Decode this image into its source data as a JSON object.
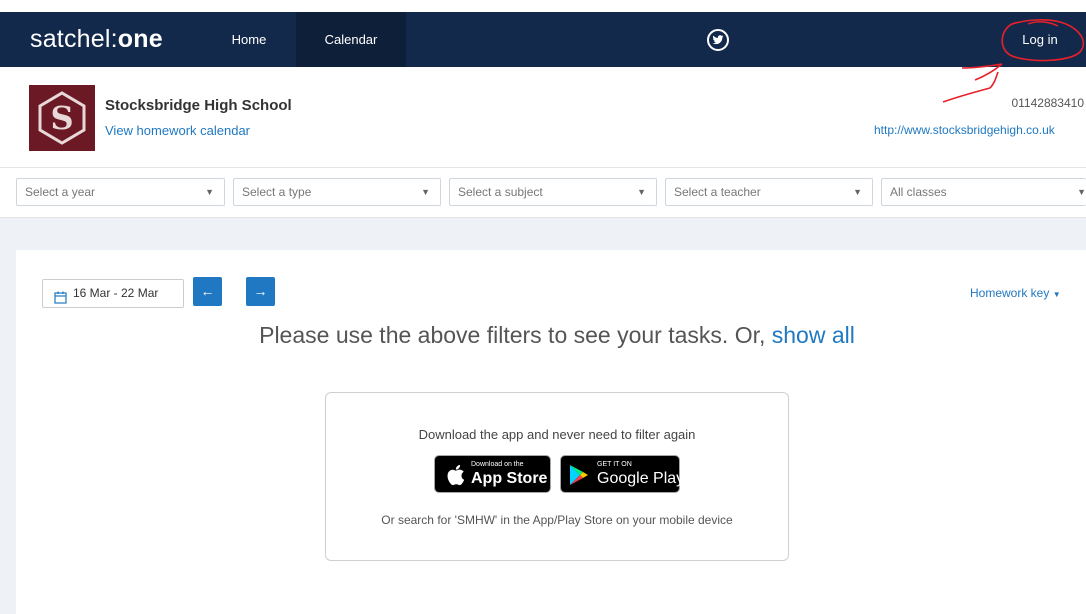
{
  "nav": {
    "brand_plain": "satchel:",
    "brand_bold": "one",
    "home": "Home",
    "calendar": "Calendar",
    "login": "Log in",
    "twitter_icon": "twitter-icon"
  },
  "school": {
    "name": "Stocksbridge High School",
    "calendar_link": "View homework calendar",
    "phone": "01142883410",
    "website": "http://www.stocksbridgehigh.co.uk"
  },
  "filters": {
    "year": "Select a year",
    "type": "Select a type",
    "subject": "Select a subject",
    "teacher": "Select a teacher",
    "classes": "All classes"
  },
  "toolbar": {
    "date_range": "16 Mar - 22 Mar",
    "prev_icon": "←",
    "next_icon": "→",
    "homework_key": "Homework key"
  },
  "main": {
    "prompt": "Please use the above filters to see your tasks. Or,",
    "show_all": "show all"
  },
  "app_promo": {
    "headline": "Download the app and never need to filter again",
    "appstore_small": "Download on the",
    "appstore_big": "App Store",
    "google_small": "GET IT ON",
    "google_big": "Google Play",
    "hint": "Or search for 'SMHW' in the App/Play Store on your mobile device"
  },
  "colors": {
    "nav_bg": "#13294b",
    "accent": "#1f78c1",
    "logo_bg": "#6b1a25",
    "annotation": "#e8202a"
  }
}
